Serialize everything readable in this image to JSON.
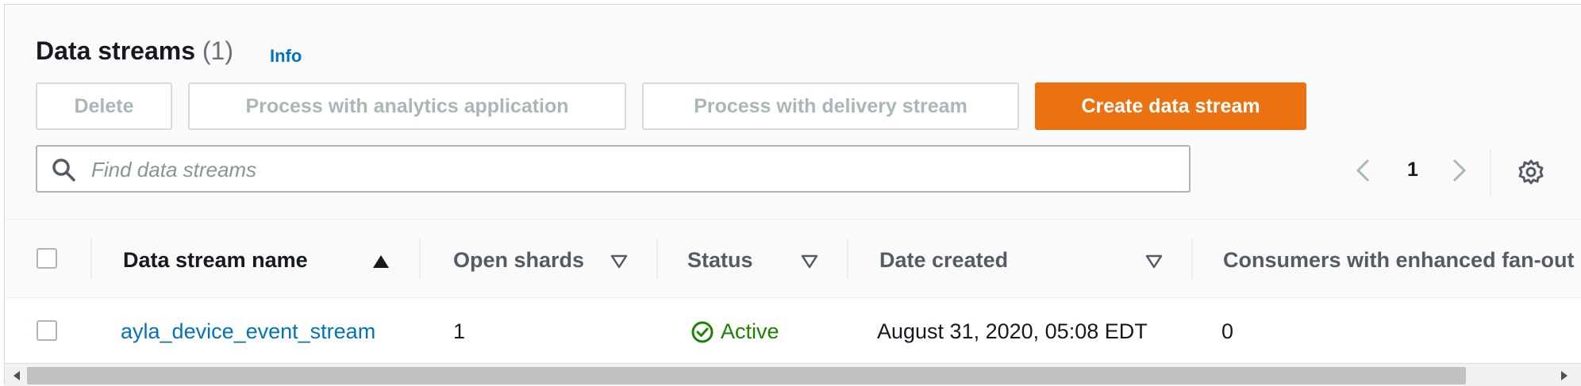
{
  "header": {
    "title": "Data streams",
    "count": "(1)",
    "info_label": "Info"
  },
  "actions": {
    "delete_label": "Delete",
    "analytics_label": "Process with analytics application",
    "delivery_label": "Process with delivery stream",
    "create_label": "Create data stream"
  },
  "search": {
    "placeholder": "Find data streams"
  },
  "pagination": {
    "current_page": "1"
  },
  "table": {
    "columns": [
      {
        "label": "Data stream name",
        "sort": "ascending"
      },
      {
        "label": "Open shards",
        "sort": "none"
      },
      {
        "label": "Status",
        "sort": "none"
      },
      {
        "label": "Date created",
        "sort": "none"
      },
      {
        "label": "Consumers with enhanced fan-out",
        "sort": "none"
      }
    ],
    "rows": [
      {
        "name": "ayla_device_event_stream",
        "open_shards": "1",
        "status": "Active",
        "date_created": "August 31, 2020, 05:08 EDT",
        "consumers": "0"
      }
    ]
  },
  "colors": {
    "primary": "#ec7211",
    "link": "#0073bb",
    "success": "#1d8102",
    "disabled_text": "#aab7b8"
  },
  "icons": [
    "search-icon",
    "chevron-left-icon",
    "chevron-right-icon",
    "gear-icon",
    "sort-ascending-icon",
    "sort-icon",
    "check-circle-icon"
  ]
}
